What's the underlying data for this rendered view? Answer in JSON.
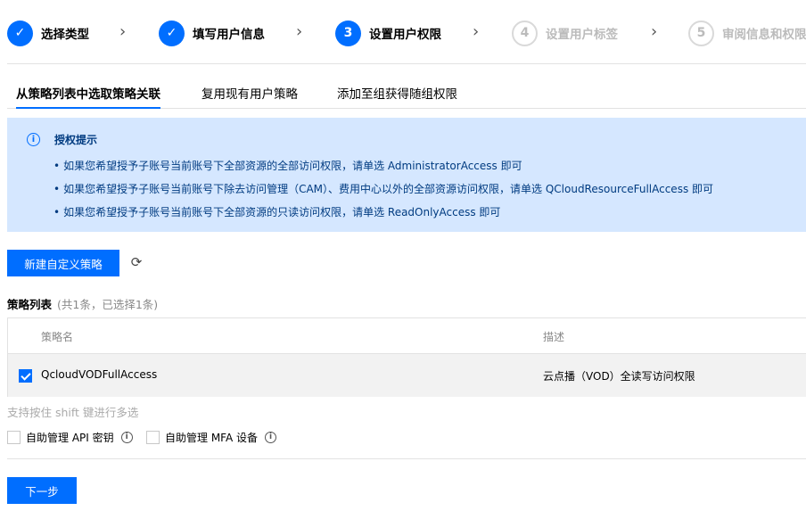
{
  "steps": [
    {
      "number": "✓",
      "label": "选择类型",
      "state": "done"
    },
    {
      "number": "✓",
      "label": "填写用户信息",
      "state": "done"
    },
    {
      "number": "3",
      "label": "设置用户权限",
      "state": "active"
    },
    {
      "number": "4",
      "label": "设置用户标签",
      "state": "todo"
    },
    {
      "number": "5",
      "label": "审阅信息和权限",
      "state": "todo"
    }
  ],
  "tabs": [
    {
      "label": "从策略列表中选取策略关联",
      "active": true
    },
    {
      "label": "复用现有用户策略",
      "active": false
    },
    {
      "label": "添加至组获得随组权限",
      "active": false
    }
  ],
  "notice": {
    "icon": "info-icon",
    "title": "授权提示",
    "lines": [
      "如果您希望授予子账号当前账号下全部资源的全部访问权限，请单选 AdministratorAccess 即可",
      "如果您希望授予子账号当前账号下除去访问管理（CAM）、费用中心以外的全部资源访问权限，请单选 QCloudResourceFullAccess 即可",
      "如果您希望授予子账号当前账号下全部资源的只读访问权限，请单选 ReadOnlyAccess 即可"
    ]
  },
  "toolbar": {
    "create_label": "新建自定义策略",
    "refresh_icon": "refresh-icon"
  },
  "policy_list": {
    "title": "策略列表",
    "count": "(共1条，已选择1条)",
    "columns": [
      "策略名",
      "描述"
    ],
    "rows": [
      {
        "name": "QcloudVODFullAccess",
        "description": "云点播（VOD）全读写访问权限",
        "checked": true
      }
    ]
  },
  "hint": "支持按住 shift 键进行多选",
  "options": [
    {
      "label": "自助管理 API 密钥",
      "checked": false
    },
    {
      "label": "自助管理 MFA 设备",
      "checked": false
    }
  ],
  "footer": {
    "next_label": "下一步"
  },
  "colors": {
    "primary": "#006eff",
    "notice_bg": "#d5e7ff"
  }
}
